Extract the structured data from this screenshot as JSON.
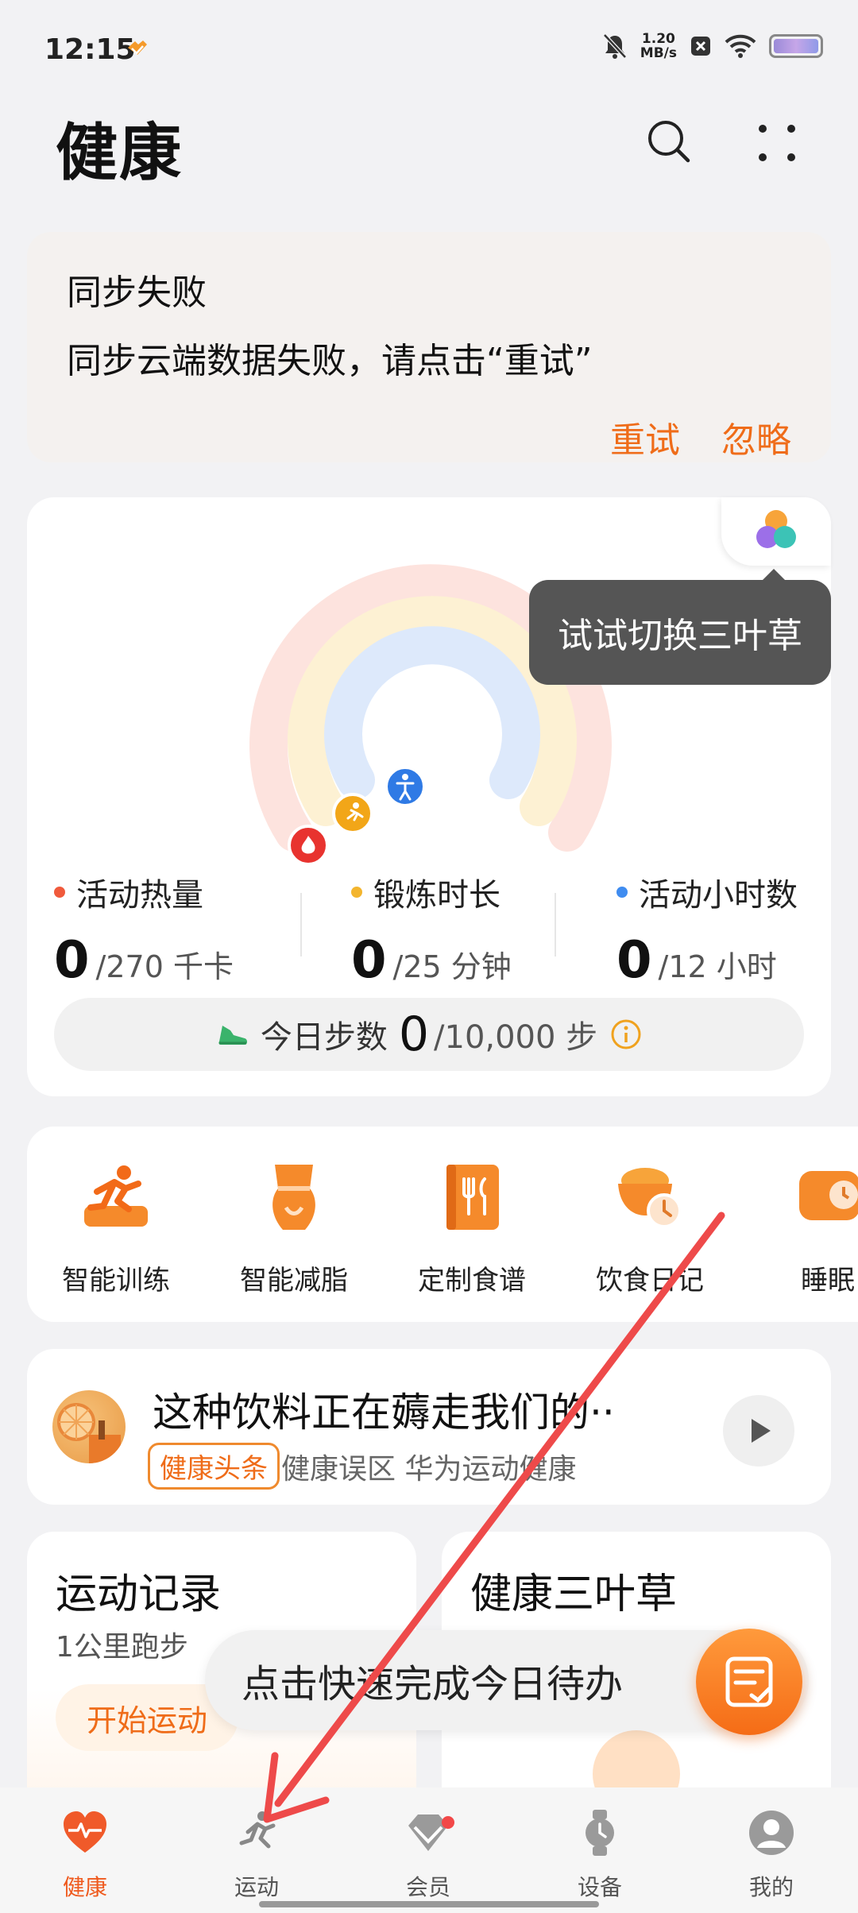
{
  "status_bar": {
    "time": "12:15",
    "net_speed_value": "1.20",
    "net_speed_unit": "MB/s"
  },
  "header": {
    "title": "健康"
  },
  "sync_card": {
    "title": "同步失败",
    "message": "同步云端数据失败，请点击“重试”",
    "retry_label": "重试",
    "ignore_label": "忽略"
  },
  "tooltip": {
    "text": "试试切换三叶草"
  },
  "metrics": [
    {
      "label": "活动热量",
      "value": "0",
      "total": "/270 千卡",
      "color": "#f05a3c"
    },
    {
      "label": "锻炼时长",
      "value": "0",
      "total": "/25 分钟",
      "color": "#f3b52e"
    },
    {
      "label": "活动小时数",
      "value": "0",
      "total": "/12 小时",
      "color": "#3f8cf0"
    }
  ],
  "steps": {
    "label": "今日步数",
    "value": "0",
    "total": "/10,000 步"
  },
  "features": [
    {
      "label": "智能训练",
      "icon": "running-training-icon"
    },
    {
      "label": "智能减脂",
      "icon": "body-fat-icon"
    },
    {
      "label": "定制食谱",
      "icon": "recipe-book-icon"
    },
    {
      "label": "饮食日记",
      "icon": "meal-diary-icon"
    },
    {
      "label": "睡眠",
      "icon": "sleep-icon"
    }
  ],
  "news": {
    "title": "这种饮料正在薅走我们的··",
    "tag": "健康头条",
    "meta": "健康误区 华为运动健康"
  },
  "exercise_card": {
    "title": "运动记录",
    "subtitle": "1公里跑步",
    "button": "开始运动"
  },
  "trefoil_card": {
    "title": "健康三叶草"
  },
  "todo": {
    "text": "点击快速完成今日待办"
  },
  "nav": [
    {
      "label": "健康",
      "active": true
    },
    {
      "label": "运动",
      "active": false
    },
    {
      "label": "会员",
      "active": false
    },
    {
      "label": "设备",
      "active": false
    },
    {
      "label": "我的",
      "active": false
    }
  ],
  "colors": {
    "accent": "#ef6c19",
    "ring_red": "#f05a3c",
    "ring_yellow": "#f3b52e",
    "ring_blue": "#3f8cf0",
    "annotation_arrow": "#ee4a4a"
  }
}
